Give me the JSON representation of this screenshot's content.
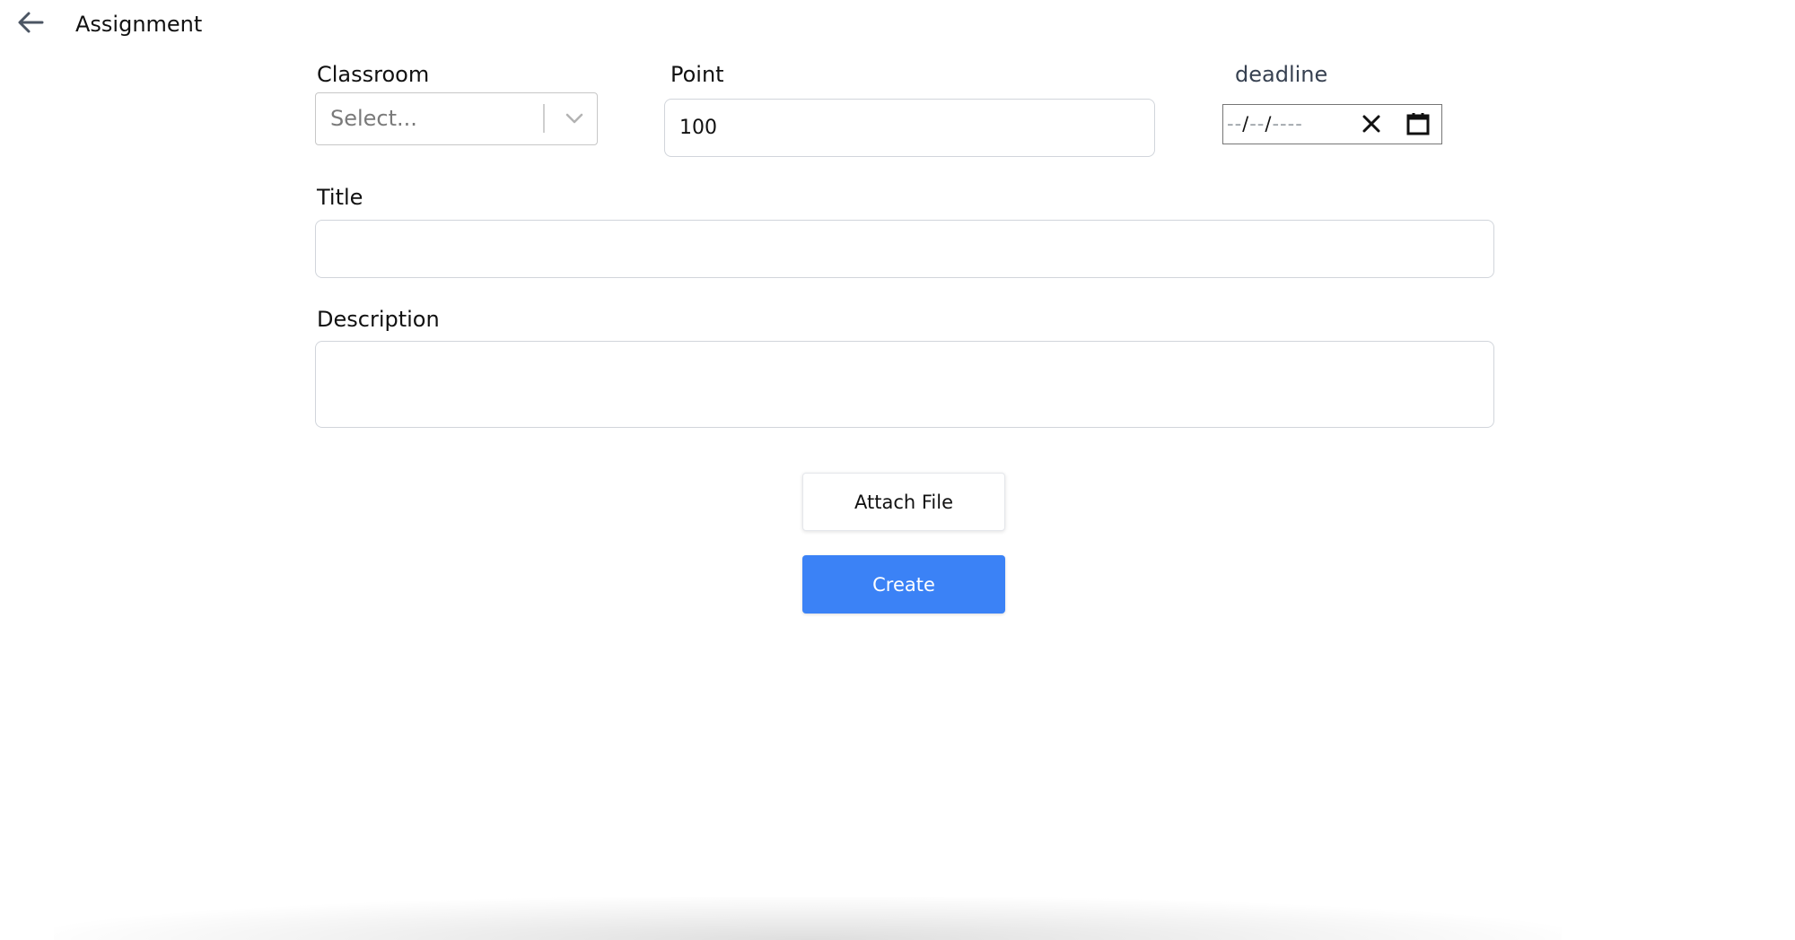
{
  "header": {
    "back_icon": "arrow-left-icon",
    "title": "Assignment"
  },
  "form": {
    "classroom": {
      "label": "Classroom",
      "placeholder": "Select...",
      "icon": "chevron-down-icon"
    },
    "point": {
      "label": "Point",
      "value": "100"
    },
    "deadline": {
      "label": "deadline",
      "placeholder_parts": [
        "--",
        "/",
        "--",
        "/",
        "----"
      ],
      "clear_icon": "close-icon",
      "calendar_icon": "calendar-icon"
    },
    "title": {
      "label": "Title",
      "value": ""
    },
    "description": {
      "label": "Description",
      "value": ""
    }
  },
  "actions": {
    "attach_label": "Attach File",
    "create_label": "Create"
  },
  "colors": {
    "primary": "#3b82f6",
    "border": "#d1d5db"
  }
}
